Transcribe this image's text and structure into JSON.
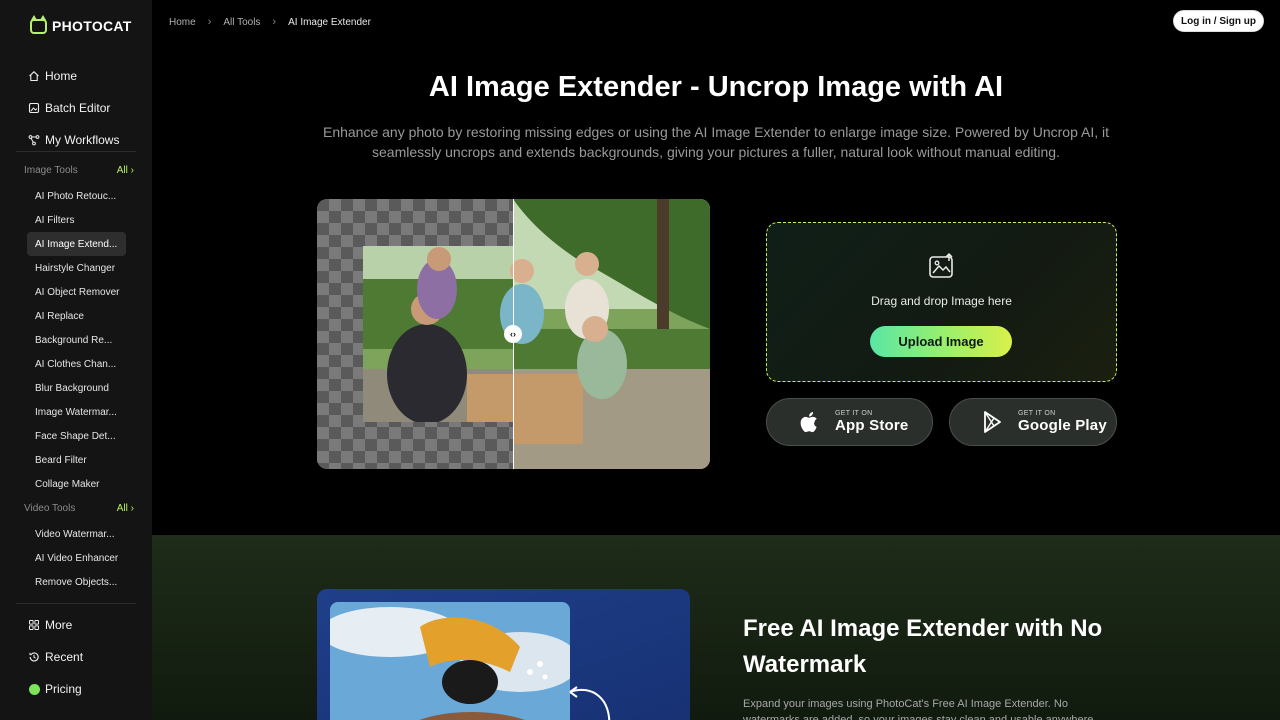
{
  "brand": {
    "name": "PHOTOCAT"
  },
  "sidebar": {
    "main_nav": [
      {
        "label": "Home",
        "icon": "home-icon"
      },
      {
        "label": "Batch Editor",
        "icon": "image-icon"
      },
      {
        "label": "My Workflows",
        "icon": "workflow-icon"
      }
    ],
    "image_tools": {
      "heading": "Image Tools",
      "all_label": "All",
      "items": [
        "AI Photo Retouc...",
        "AI Filters",
        "AI Image Extend...",
        "Hairstyle Changer",
        "AI Object Remover",
        "AI Replace",
        "Background Re...",
        "AI Clothes Chan...",
        "Blur Background",
        "Image Watermar...",
        "Face Shape Det...",
        "Beard Filter",
        "Collage Maker"
      ],
      "active_index": 2
    },
    "video_tools": {
      "heading": "Video Tools",
      "all_label": "All",
      "items": [
        "Video Watermar...",
        "AI Video Enhancer",
        "Remove Objects..."
      ]
    },
    "bottom_nav": [
      {
        "label": "More",
        "icon": "grid-icon"
      },
      {
        "label": "Recent",
        "icon": "history-icon"
      },
      {
        "label": "Pricing",
        "icon": "pricing-icon"
      }
    ]
  },
  "header": {
    "breadcrumb": [
      "Home",
      "All Tools",
      "AI Image Extender"
    ],
    "login_label": "Log in / Sign up"
  },
  "hero": {
    "title": "AI Image Extender - Uncrop Image with AI",
    "subtitle": "Enhance any photo by restoring missing edges or using the AI Image Extender to enlarge image size. Powered by Uncrop AI, it seamlessly uncrops and extends backgrounds, giving your pictures a fuller, natural look without manual editing."
  },
  "upload": {
    "drop_text": "Drag and drop Image here",
    "button_label": "Upload Image"
  },
  "stores": {
    "app_store": {
      "small": "GET IT ON",
      "big": "App Store"
    },
    "google_play": {
      "small": "GET IT ON",
      "big": "Google Play"
    }
  },
  "feature": {
    "title": "Free AI Image Extender with No Watermark",
    "text": "Expand your images using PhotoCat's Free AI Image Extender. No watermarks are added, so your images stay clean and usable anywhere."
  },
  "colors": {
    "accent": "#b7f06a",
    "background": "#000000",
    "sidebar": "#141414"
  }
}
